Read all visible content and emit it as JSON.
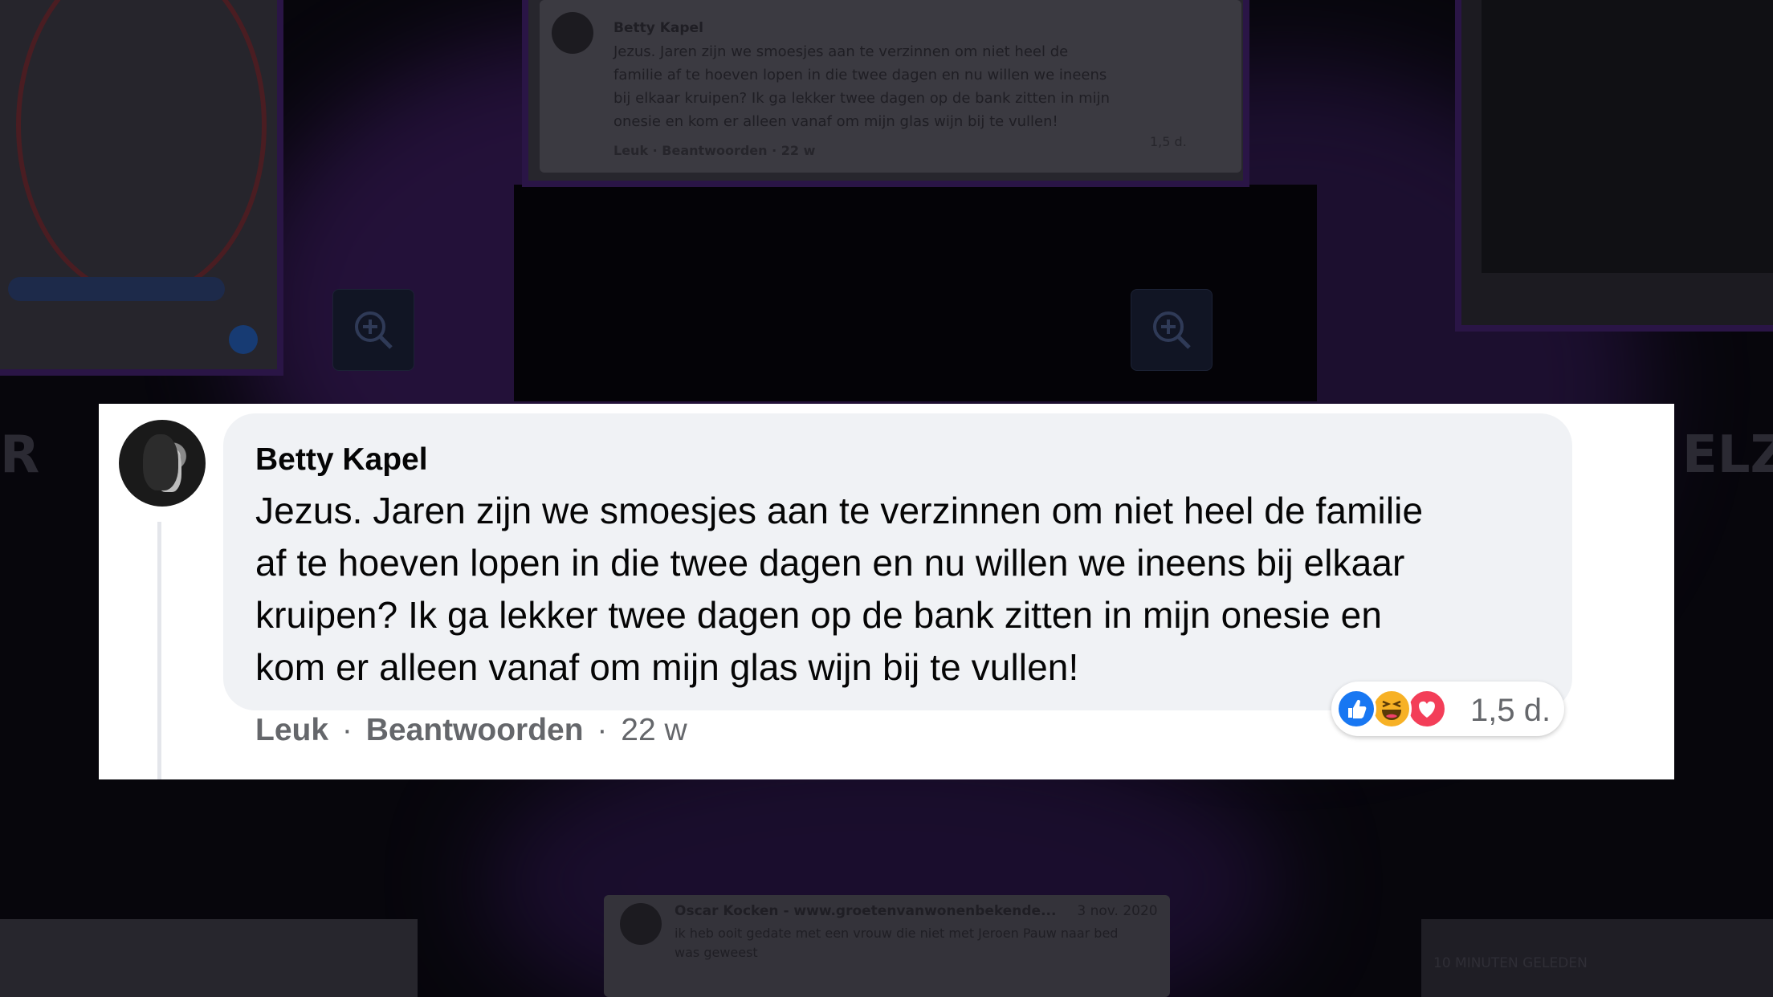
{
  "background": {
    "top_card": {
      "author": "Betty Kapel",
      "text": [
        "Jezus. Jaren zijn we smoesjes aan te verzinnen om niet heel de",
        "familie af te hoeven lopen in die twee dagen en nu willen we ineens",
        "bij elkaar kruipen? Ik ga lekker twee dagen op de bank zitten in mijn",
        "onesie en kom er alleen vanaf om mijn glas wijn bij te vullen!"
      ],
      "meta": "Leuk · Beantwoorden · 22 w",
      "count": "1,5 d."
    },
    "bottom_card": {
      "author": "Oscar Kocken - www.groetenvanwonenbekende...",
      "date": "3 nov. 2020",
      "text": [
        "ik heb ooit gedate met een vrouw die niet met Jeroen Pauw naar bed",
        "was geweest"
      ]
    },
    "side_word_left": "R",
    "side_word_right": "ELZE",
    "right_label": "10 MINUTEN GELEDEN"
  },
  "comment": {
    "author": "Betty Kapel",
    "lines": [
      "Jezus. Jaren zijn we smoesjes aan te verzinnen om niet heel de familie",
      "af te hoeven lopen in die twee dagen en nu willen we ineens bij elkaar",
      "kruipen? Ik ga lekker twee dagen op de bank zitten in mijn onesie en",
      "kom er alleen vanaf om mijn glas wijn bij te vullen!"
    ],
    "like_label": "Leuk",
    "reply_label": "Beantwoorden",
    "separator": "·",
    "time": "22 w",
    "reaction_count": "1,5 d.",
    "reactions": [
      "like-icon",
      "haha-icon",
      "love-icon"
    ]
  },
  "colors": {
    "like": "#1877f2",
    "haha": "#f7b125",
    "love": "#f33e58",
    "bubble": "#f0f2f5",
    "meta_text": "#65676b"
  }
}
